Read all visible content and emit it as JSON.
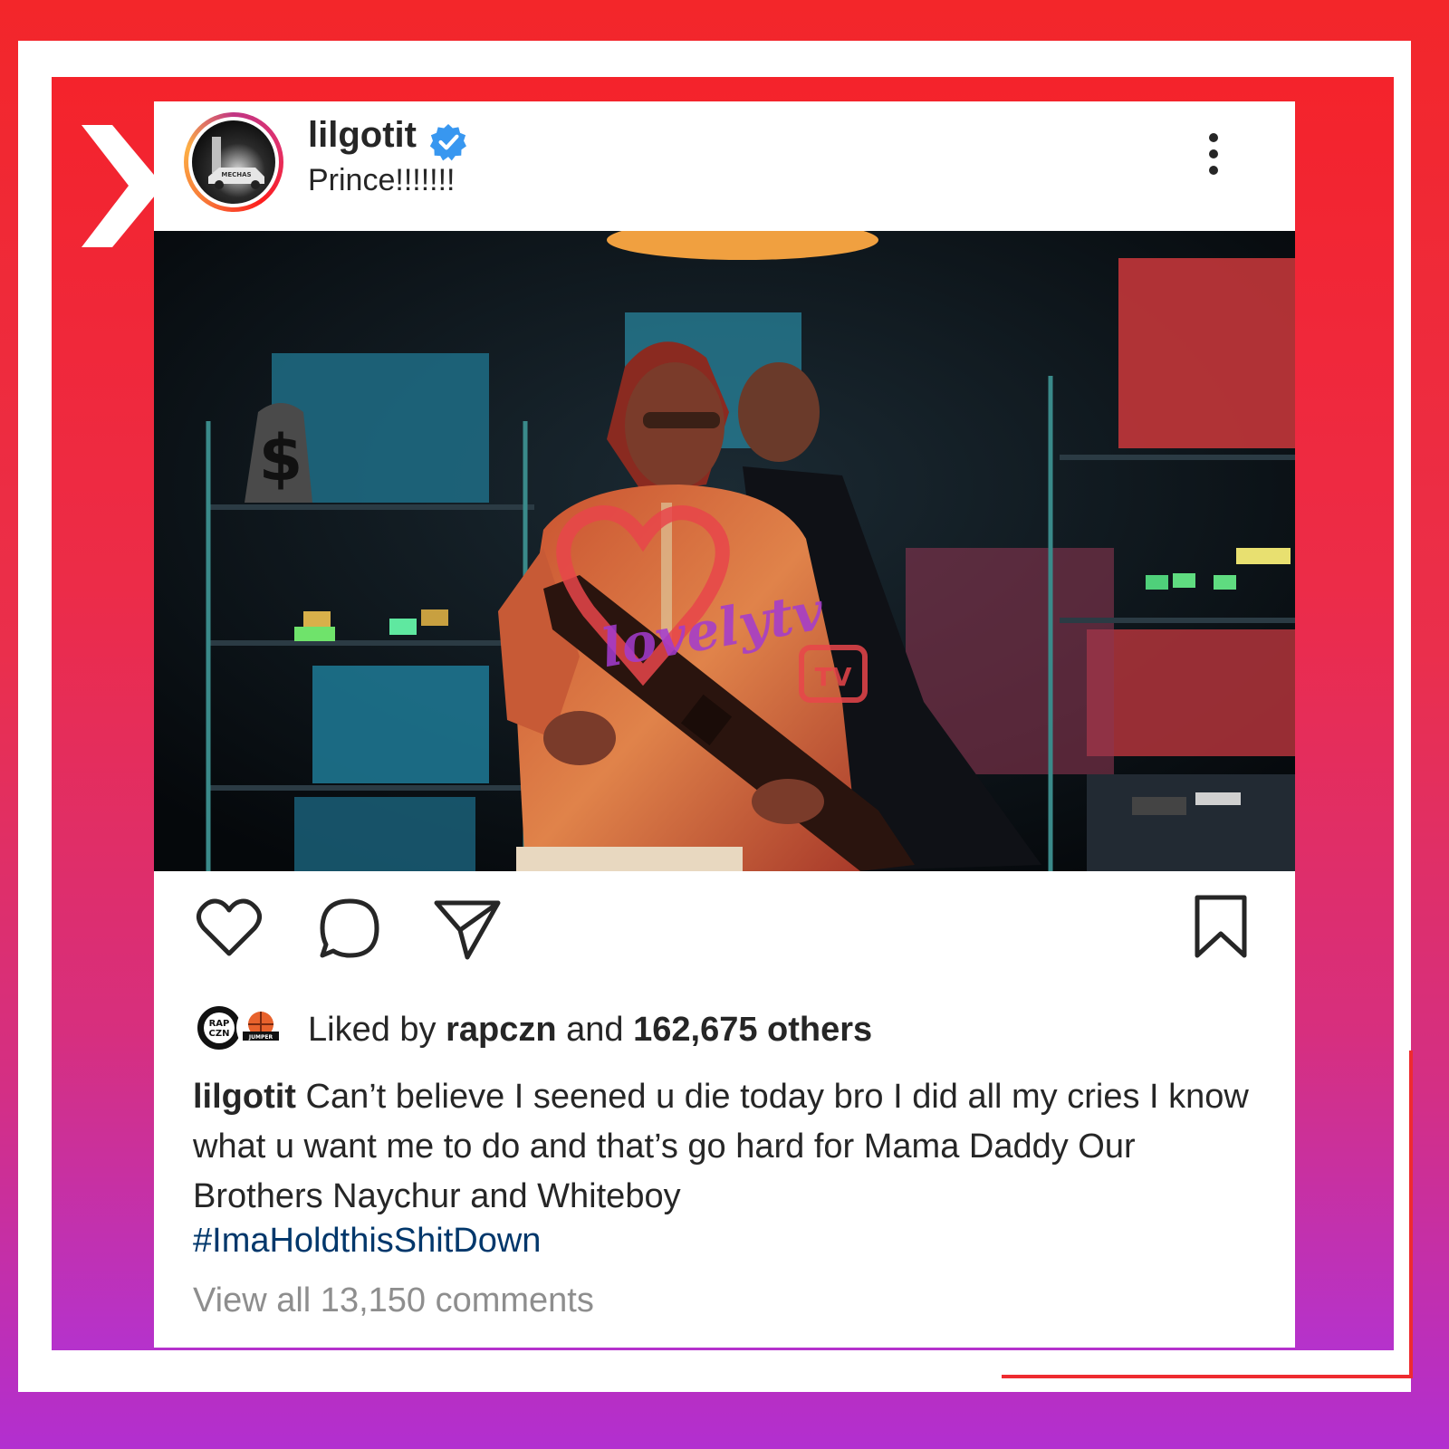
{
  "post": {
    "username": "lilgotit",
    "header_subtitle": "Prince!!!!!!!",
    "verified": true,
    "more_icon": "more-vertical-icon",
    "avatar_badge_text": "MECHAS"
  },
  "photo": {
    "watermark_text": "lovelytv",
    "watermark_badge": "TV"
  },
  "actions": {
    "like_icon": "heart-icon",
    "comment_icon": "comment-icon",
    "share_icon": "send-icon",
    "save_icon": "bookmark-icon"
  },
  "likes": {
    "avatar1_text_line1": "RAP",
    "avatar1_text_line2": "CZN",
    "avatar2_text": "JUMPER",
    "prefix": "Liked by",
    "user": "rapczn",
    "middle": "and",
    "count": "162,675 others"
  },
  "caption": {
    "user": "lilgotit",
    "text": "Can’t believe I seened u die today bro I did all my cries I know what u want me to do and that’s go hard for Mama Daddy Our Brothers Naychur and Whiteboy",
    "hashtag": "#ImaHoldthisShitDown"
  },
  "comments": {
    "label": "View all 13,150 comments"
  },
  "colors": {
    "frame_red": "#f3262a",
    "frame_purple": "#b22fd0",
    "verified_blue": "#3897f0",
    "hashtag_blue": "#00376b",
    "muted_gray": "#8e8e8e"
  }
}
